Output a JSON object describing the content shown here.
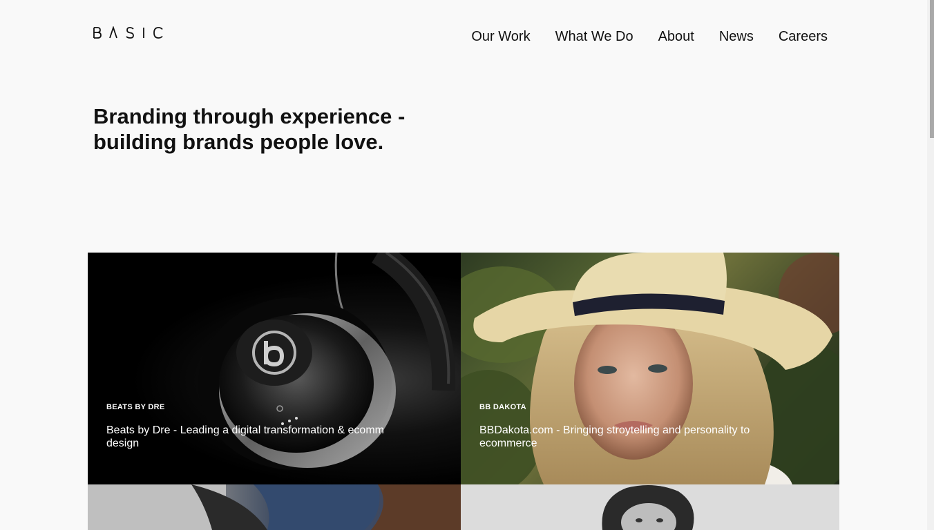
{
  "header": {
    "logo_text": "BASIC",
    "nav": [
      {
        "label": "Our Work"
      },
      {
        "label": "What We Do"
      },
      {
        "label": "About"
      },
      {
        "label": "News"
      },
      {
        "label": "Careers"
      }
    ]
  },
  "hero": {
    "headline_line1": "Branding through experience -",
    "headline_line2": "building brands people love."
  },
  "projects": [
    {
      "category": "BEATS BY DRE",
      "title": "Beats by Dre - Leading a digital transformation & ecomm design",
      "image": "headphones-photo"
    },
    {
      "category": "BB DAKOTA",
      "title": "BBDakota.com - Bringing stroytelling and personality to ecommerce",
      "image": "woman-in-straw-hat-photo"
    },
    {
      "category": "",
      "title": "",
      "image": "jacket-photo"
    },
    {
      "category": "",
      "title": "",
      "image": "portrait-photo"
    }
  ]
}
